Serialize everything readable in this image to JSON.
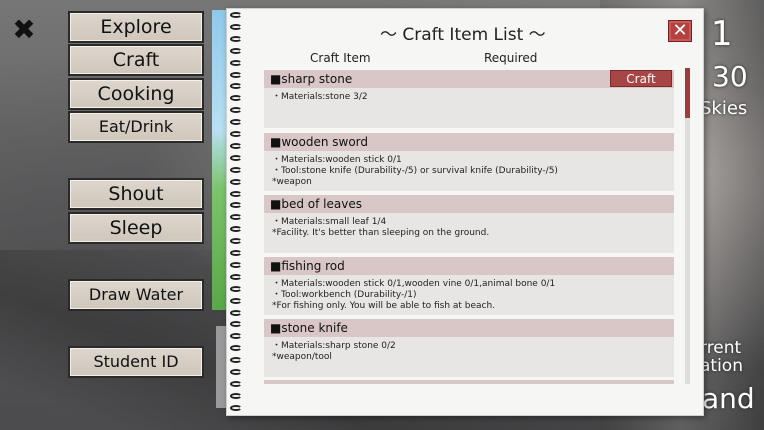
{
  "hud": {
    "day": "y 1",
    "time": "30",
    "weather": "Skies",
    "bottom1": "rrent",
    "bottom2": "ation",
    "bottom3": "and"
  },
  "menu": {
    "close_glyph": "✖",
    "buttons": [
      "Explore",
      "Craft",
      "Cooking",
      "Eat/Drink",
      "Shout",
      "Sleep",
      "Draw Water",
      "Student ID"
    ]
  },
  "dialog": {
    "title": "～ Craft Item List ～",
    "close_glyph": "✕",
    "col_item": "Craft Item",
    "col_required": "Required",
    "craft_label": "Craft",
    "items": [
      {
        "name": "■sharp stone",
        "lines": [
          "・Materials:stone 3/2"
        ],
        "craftable": true
      },
      {
        "name": "■wooden sword",
        "lines": [
          "・Materials:wooden stick 0/1",
          "・Tool:stone knife (Durability-/5)  or survival knife (Durability-/5)",
          "*weapon"
        ],
        "craftable": false
      },
      {
        "name": "■bed of leaves",
        "lines": [
          "・Materials:small leaf 1/4",
          "*Facility. It's better than sleeping on the ground."
        ],
        "craftable": false
      },
      {
        "name": "■fishing rod",
        "lines": [
          "・Materials:wooden stick 0/1,wooden vine 0/1,animal bone 0/1",
          "・Tool:workbench (Durability-/1)",
          "*For fishing only. You will be able to fish at beach."
        ],
        "craftable": false
      },
      {
        "name": "■stone knife",
        "lines": [
          "・Materials:sharp stone 0/2",
          "*weapon/tool"
        ],
        "craftable": false
      }
    ]
  },
  "colors": {
    "accent": "#a74646",
    "item_header": "#d9c6c6",
    "item_body": "#e8e6e4"
  }
}
